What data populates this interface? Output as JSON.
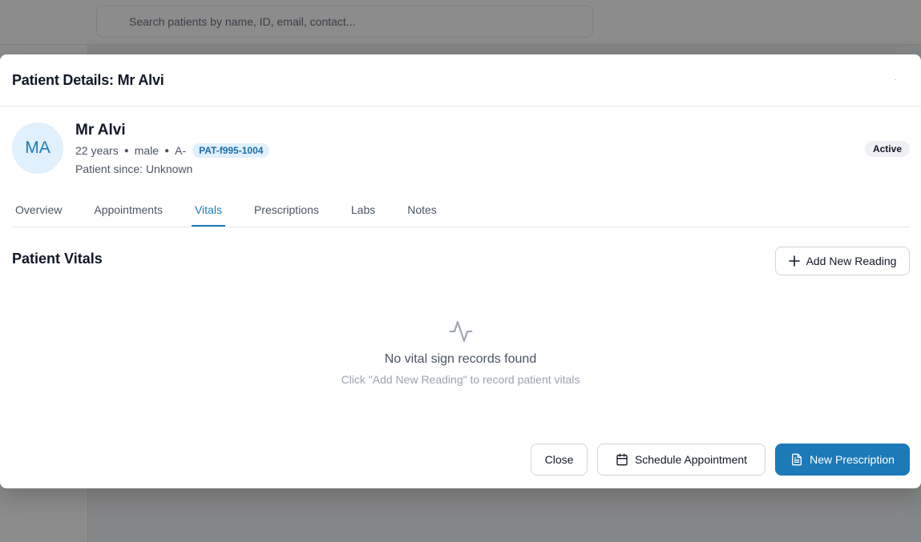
{
  "background": {
    "search_placeholder": "Search patients by name, ID, email, contact..."
  },
  "modal": {
    "title": "Patient Details: Mr Alvi",
    "close_icon": "close-icon"
  },
  "patient": {
    "initials": "MA",
    "name": "Mr Alvi",
    "age": "22 years",
    "gender": "male",
    "blood_type": "A-",
    "patient_id": "PAT-f995-1004",
    "since": "Patient since: Unknown",
    "status": "Active"
  },
  "tabs": [
    {
      "label": "Overview"
    },
    {
      "label": "Appointments"
    },
    {
      "label": "Vitals",
      "active": true
    },
    {
      "label": "Prescriptions"
    },
    {
      "label": "Labs"
    },
    {
      "label": "Notes"
    }
  ],
  "vitals": {
    "title": "Patient Vitals",
    "add_button": "Add New Reading",
    "empty_title": "No vital sign records found",
    "empty_subtitle": "Click \"Add New Reading\" to record patient vitals"
  },
  "footer": {
    "close": "Close",
    "schedule": "Schedule Appointment",
    "new_prescription": "New Prescription"
  },
  "colors": {
    "accent": "#1d7ab8",
    "accent_light": "#e0f0fc"
  }
}
